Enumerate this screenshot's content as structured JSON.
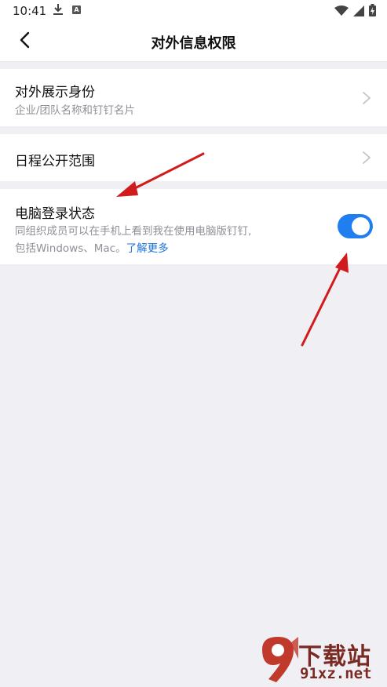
{
  "status_bar": {
    "time": "10:41",
    "icons": [
      "download-icon",
      "notification-a-icon",
      "wifi-icon",
      "signal-icon",
      "battery-charging-icon"
    ]
  },
  "header": {
    "title": "对外信息权限",
    "back_icon": "chevron-left-icon"
  },
  "settings": {
    "external_identity": {
      "title": "对外展示身份",
      "subtitle": "企业/团队名称和钉钉名片"
    },
    "schedule_scope": {
      "title": "日程公开范围"
    },
    "pc_login_status": {
      "title": "电脑登录状态",
      "description_line1": "同组织成员可以在手机上看到我在使用电脑版钉钉,",
      "description_line2": "包括Windows、Mac。",
      "learn_more": "了解更多",
      "enabled": true
    }
  },
  "colors": {
    "accent": "#1f7ef0",
    "link": "#1a73d9",
    "background": "#f0eff4",
    "annotation_arrow": "#d01c1c"
  },
  "watermark": {
    "text1": "下载站",
    "text2": "91xz.net",
    "logo_glyph": "9"
  }
}
